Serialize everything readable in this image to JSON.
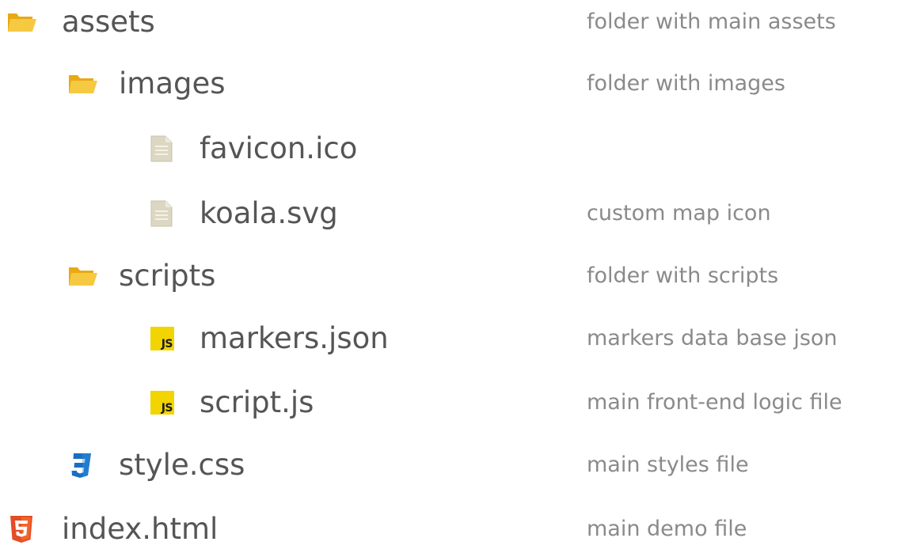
{
  "tree": [
    {
      "name": "assets",
      "description": "folder with main assets",
      "icon": "folder-icon",
      "level": 0
    },
    {
      "name": "images",
      "description": "folder with images",
      "icon": "folder-icon",
      "level": 1
    },
    {
      "name": "favicon.ico",
      "description": "",
      "icon": "file-icon",
      "level": 2
    },
    {
      "name": "koala.svg",
      "description": "custom map icon",
      "icon": "file-icon",
      "level": 2
    },
    {
      "name": "scripts",
      "description": "folder with scripts",
      "icon": "folder-icon",
      "level": 1
    },
    {
      "name": "markers.json",
      "description": "markers data base json",
      "icon": "js-icon",
      "level": 2
    },
    {
      "name": "script.js",
      "description": "main front-end logic file",
      "icon": "js-icon",
      "level": 2
    },
    {
      "name": "style.css",
      "description": "main styles file",
      "icon": "css3-icon",
      "level": 1
    },
    {
      "name": "index.html",
      "description": "main demo file",
      "icon": "html5-icon",
      "level": 0
    }
  ],
  "badges": {
    "js": "JS"
  },
  "colors": {
    "folder": "#f3c234",
    "file": "#d9d4bf",
    "js": "#f2d400",
    "css3": "#1a6fc2",
    "html5": "#e44d26",
    "name_text": "#555555",
    "desc_text": "#8a8a8a"
  }
}
